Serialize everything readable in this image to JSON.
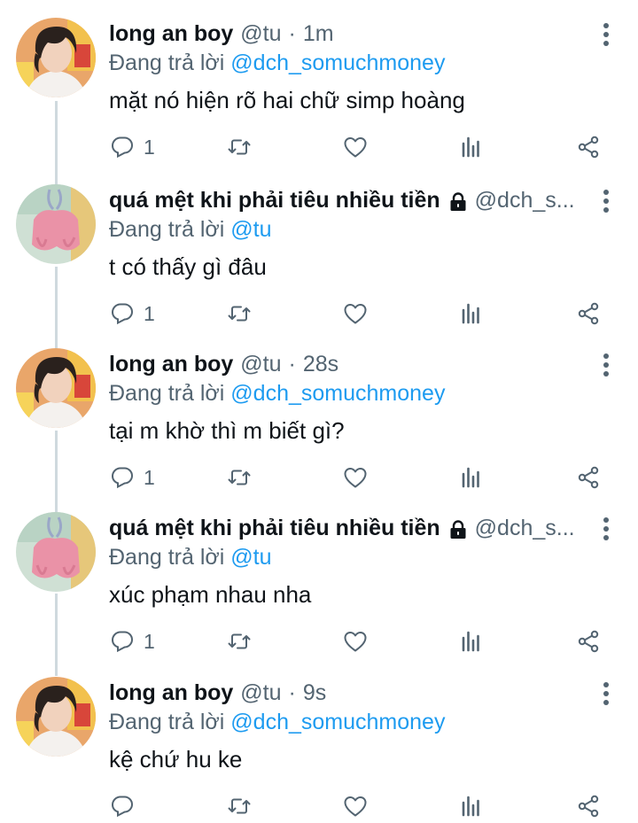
{
  "reply_prefix": "Đang trả lời",
  "tweets": [
    {
      "avatar": "boy-avatar",
      "name": "long an boy",
      "handle": "@tu",
      "time": "1m",
      "locked": false,
      "reply_to": "@dch_somuchmoney",
      "text": "mặt nó hiện rõ hai chữ simp hoàng",
      "replies": "1"
    },
    {
      "avatar": "bunny-avatar",
      "name": "quá mệt khi phải tiêu nhiều tiền",
      "handle": "@dch_s...",
      "time": "",
      "locked": true,
      "reply_to": "@tu",
      "text": "t có thấy gì đâu",
      "replies": "1"
    },
    {
      "avatar": "boy-avatar",
      "name": "long an boy",
      "handle": "@tu",
      "time": "28s",
      "locked": false,
      "reply_to": "@dch_somuchmoney",
      "text": "tại m khờ thì m biết gì?",
      "replies": "1"
    },
    {
      "avatar": "bunny-avatar",
      "name": "quá mệt khi phải tiêu nhiều tiền",
      "handle": "@dch_s...",
      "time": "",
      "locked": true,
      "reply_to": "@tu",
      "text": "xúc phạm nhau nha",
      "replies": "1"
    },
    {
      "avatar": "boy-avatar",
      "name": "long an boy",
      "handle": "@tu",
      "time": "9s",
      "locked": false,
      "reply_to": "@dch_somuchmoney",
      "text": "kệ chứ hu ke",
      "replies": ""
    }
  ],
  "icons": {
    "reply": "reply-icon",
    "retweet": "retweet-icon",
    "like": "heart-icon",
    "views": "views-icon",
    "share": "share-icon",
    "more": "more-vertical-icon",
    "lock": "lock-icon"
  },
  "colors": {
    "text": "#0f1419",
    "secondary": "#536471",
    "link": "#1d9bf0",
    "thread_line": "#cfd9de"
  }
}
